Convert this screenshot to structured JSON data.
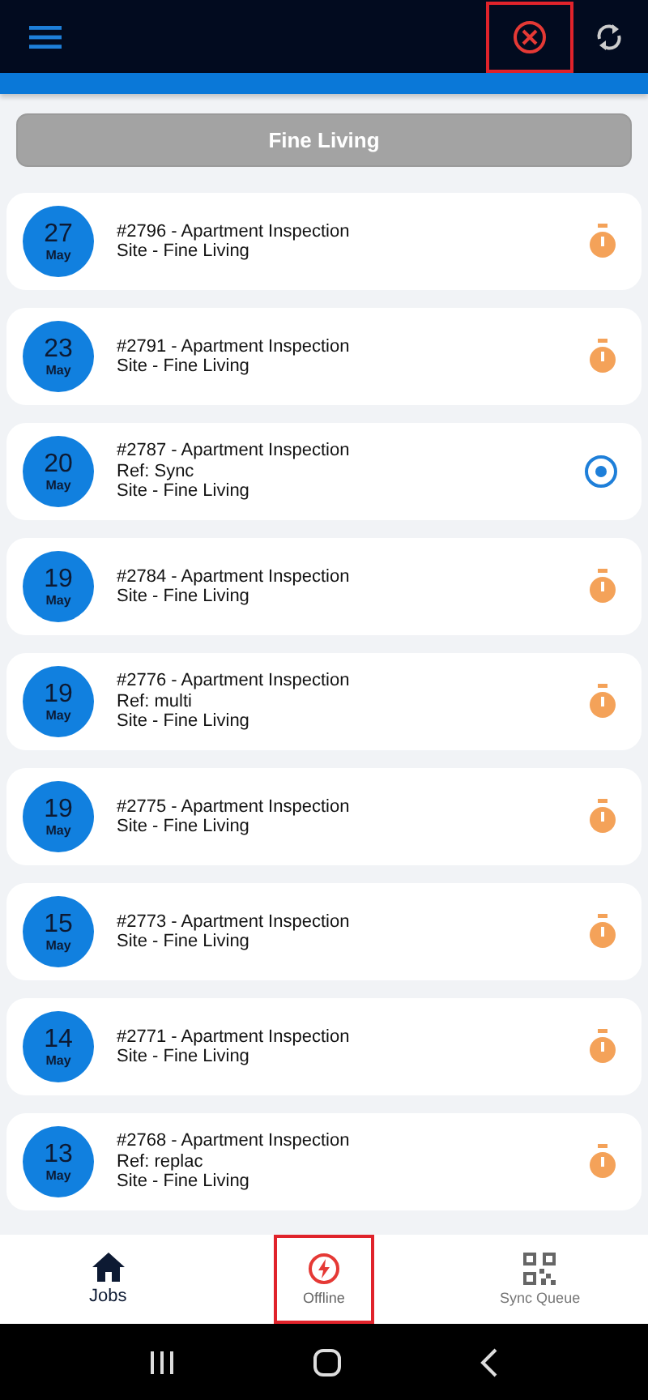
{
  "header": {
    "offline_indicator": {
      "highlighted": true
    }
  },
  "filter_button": {
    "label": "Fine Living"
  },
  "jobs": [
    {
      "day": "27",
      "month": "May",
      "lines": [
        "#2796 - Apartment Inspection",
        "Site - Fine Living"
      ],
      "status_icon": {
        "kind": "timer"
      }
    },
    {
      "day": "23",
      "month": "May",
      "lines": [
        "#2791 - Apartment Inspection",
        "Site - Fine Living"
      ],
      "status_icon": {
        "kind": "timer"
      }
    },
    {
      "day": "20",
      "month": "May",
      "lines": [
        "#2787 - Apartment Inspection",
        "Ref: Sync",
        "Site - Fine Living"
      ],
      "status_icon": {
        "kind": "active"
      }
    },
    {
      "day": "19",
      "month": "May",
      "lines": [
        "#2784 - Apartment Inspection",
        "Site - Fine Living"
      ],
      "status_icon": {
        "kind": "timer"
      }
    },
    {
      "day": "19",
      "month": "May",
      "lines": [
        "#2776 - Apartment Inspection",
        "Ref: multi",
        "Site - Fine Living"
      ],
      "status_icon": {
        "kind": "timer"
      }
    },
    {
      "day": "19",
      "month": "May",
      "lines": [
        "#2775 - Apartment Inspection",
        "Site - Fine Living"
      ],
      "status_icon": {
        "kind": "timer"
      }
    },
    {
      "day": "15",
      "month": "May",
      "lines": [
        "#2773 - Apartment Inspection",
        "Site - Fine Living"
      ],
      "status_icon": {
        "kind": "timer"
      }
    },
    {
      "day": "14",
      "month": "May",
      "lines": [
        "#2771 - Apartment Inspection",
        "Site - Fine Living"
      ],
      "status_icon": {
        "kind": "timer"
      }
    },
    {
      "day": "13",
      "month": "May",
      "lines": [
        "#2768 - Apartment Inspection",
        "Ref: replac",
        "Site - Fine Living"
      ],
      "status_icon": {
        "kind": "timer"
      }
    }
  ],
  "bottom_nav": [
    {
      "kind": "home",
      "label": "Jobs",
      "selected": true,
      "highlighted": false
    },
    {
      "kind": "offline",
      "label": "Offline",
      "selected": false,
      "highlighted": true
    },
    {
      "kind": "qr",
      "label": "Sync Queue",
      "selected": false,
      "highlighted": false
    }
  ]
}
